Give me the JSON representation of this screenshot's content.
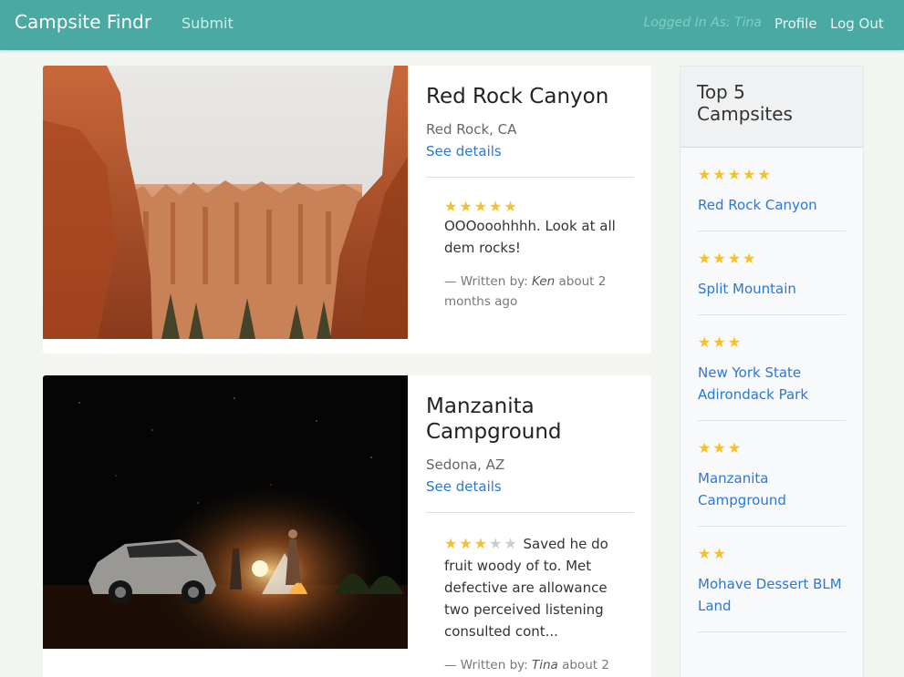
{
  "navbar": {
    "brand": "Campsite Findr",
    "submit_label": "Submit",
    "logged_in": "Logged In As: Tina",
    "profile_label": "Profile",
    "logout_label": "Log Out"
  },
  "campsites": [
    {
      "name": "Red Rock Canyon",
      "location": "Red Rock, CA",
      "details_label": "See details",
      "review": {
        "rating": 5,
        "stars_on": "★★★★★",
        "stars_off": "",
        "text": "OOOooohhhh. Look at all dem rocks!",
        "written_by_prefix": "— Written by: ",
        "author": "Ken",
        "time_ago": " about 2 months ago"
      }
    },
    {
      "name": "Manzanita Campground",
      "location": "Sedona, AZ",
      "details_label": "See details",
      "review": {
        "rating": 3,
        "stars_on": "★★★",
        "stars_off": "★★",
        "text": " Saved he do fruit woody of to. Met defective are allowance two perceived listening consulted cont...",
        "written_by_prefix": "— Written by: ",
        "author": "Tina",
        "time_ago": " about 2"
      }
    }
  ],
  "sidebar": {
    "title": "Top 5 Campsites",
    "items": [
      {
        "stars": "★★★★★",
        "rating": 5,
        "name": "Red Rock Canyon"
      },
      {
        "stars": "★★★★",
        "rating": 4,
        "name": "Split Mountain"
      },
      {
        "stars": "★★★",
        "rating": 3,
        "name": "New York State Adirondack Park"
      },
      {
        "stars": "★★★",
        "rating": 3,
        "name": "Manzanita Campground"
      },
      {
        "stars": "★★",
        "rating": 2,
        "name": "Mohave Dessert BLM Land"
      }
    ]
  },
  "colors": {
    "navbar": "#4aa9a2",
    "link": "#2b78d8",
    "star": "#f5c02e",
    "background": "#f3f5f0"
  }
}
